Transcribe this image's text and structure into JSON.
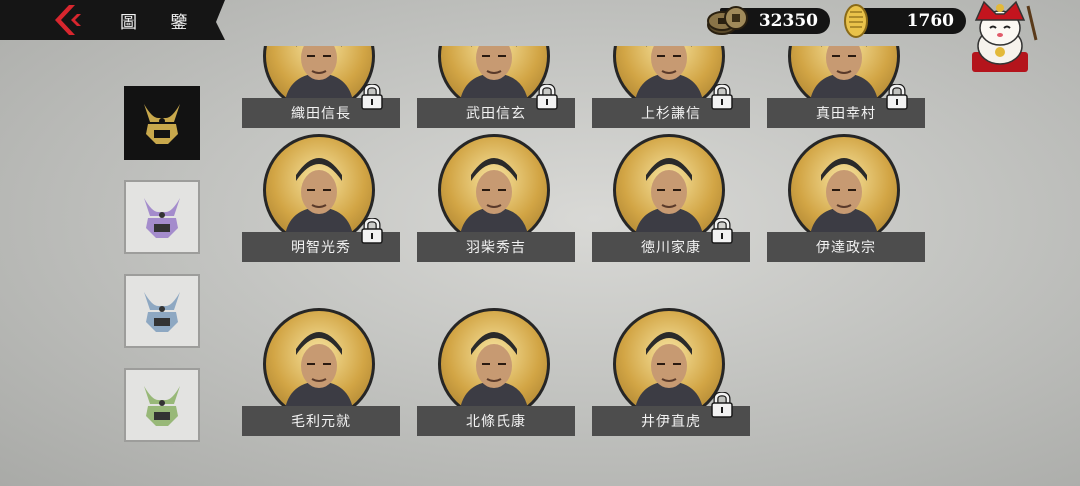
{
  "header": {
    "title": "圖 鑒"
  },
  "currency": {
    "coins": "32350",
    "gold": "1760"
  },
  "colors": {
    "tab_gold": "#c8a84c",
    "tab_purple": "#a48ccc",
    "tab_blue": "#8ea8c2",
    "tab_green": "#98b878"
  },
  "tabs": [
    {
      "icon": "kabuto-helmet-gold-icon",
      "active": true
    },
    {
      "icon": "kabuto-helmet-purple-icon",
      "active": false
    },
    {
      "icon": "kabuto-helmet-blue-icon",
      "active": false
    },
    {
      "icon": "kabuto-helmet-green-icon",
      "active": false
    }
  ],
  "warlords": [
    {
      "name": "織田信長",
      "locked": true
    },
    {
      "name": "武田信玄",
      "locked": true
    },
    {
      "name": "上杉謙信",
      "locked": true
    },
    {
      "name": "真田幸村",
      "locked": true
    },
    {
      "name": "明智光秀",
      "locked": true
    },
    {
      "name": "羽柴秀吉",
      "locked": false
    },
    {
      "name": "徳川家康",
      "locked": true
    },
    {
      "name": "伊達政宗",
      "locked": false
    },
    {
      "name": "毛利元就",
      "locked": false
    },
    {
      "name": "北條氏康",
      "locked": false
    },
    {
      "name": "井伊直虎",
      "locked": true
    }
  ]
}
